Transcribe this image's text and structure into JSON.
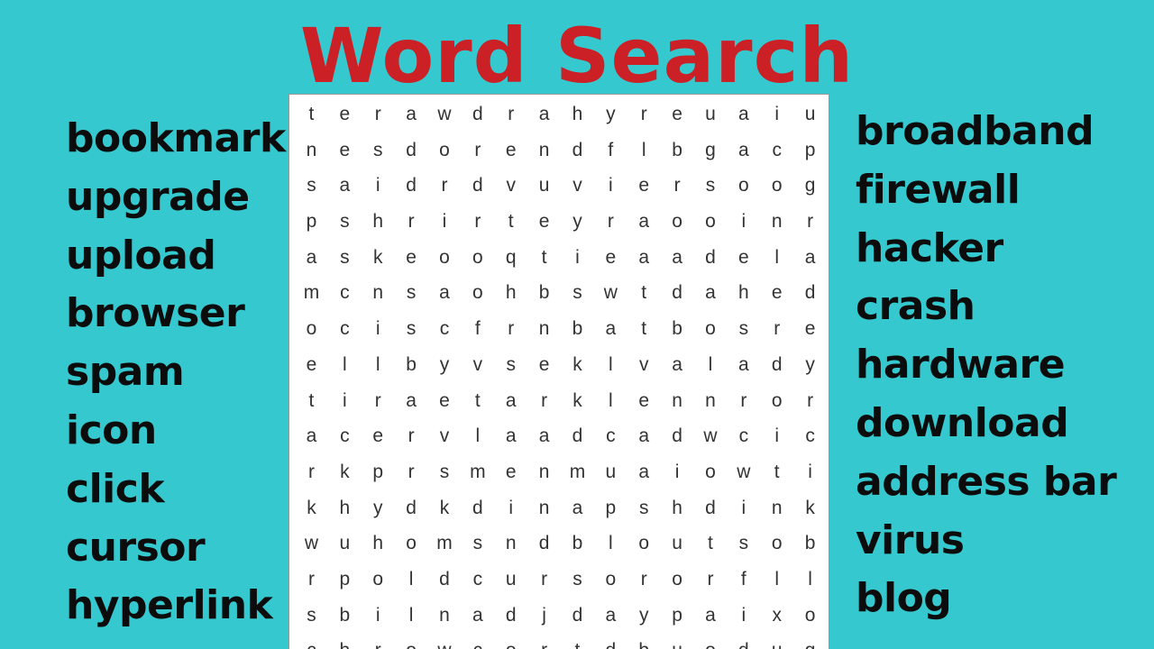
{
  "title": "Word Search",
  "colors": {
    "background": "#35c9cf",
    "title": "#cc2027",
    "grid_background": "#ffffff",
    "word_text": "#0c0c0c"
  },
  "left_words": [
    "bookmark",
    "upgrade",
    "upload",
    "browser",
    "spam",
    "icon",
    "click",
    "cursor",
    "hyperlink"
  ],
  "right_words": [
    "broadband",
    "firewall",
    "hacker",
    "crash",
    "hardware",
    "download",
    "address bar",
    "virus",
    "blog"
  ],
  "grid": [
    [
      "t",
      "e",
      "r",
      "a",
      "w",
      "d",
      "r",
      "a",
      "h",
      "y",
      "r",
      "e",
      "u",
      "a",
      "i",
      "u"
    ],
    [
      "n",
      "e",
      "s",
      "d",
      "o",
      "r",
      "e",
      "n",
      "d",
      "f",
      "l",
      "b",
      "g",
      "a",
      "c",
      "p"
    ],
    [
      "s",
      "a",
      "i",
      "d",
      "r",
      "d",
      "v",
      "u",
      "v",
      "i",
      "e",
      "r",
      "s",
      "o",
      "o",
      "g"
    ],
    [
      "p",
      "s",
      "h",
      "r",
      "i",
      "r",
      "t",
      "e",
      "y",
      "r",
      "a",
      "o",
      "o",
      "i",
      "n",
      "r"
    ],
    [
      "a",
      "s",
      "k",
      "e",
      "o",
      "o",
      "q",
      "t",
      "i",
      "e",
      "a",
      "a",
      "d",
      "e",
      "l",
      "a"
    ],
    [
      "m",
      "c",
      "n",
      "s",
      "a",
      "o",
      "h",
      "b",
      "s",
      "w",
      "t",
      "d",
      "a",
      "h",
      "e",
      "d"
    ],
    [
      "o",
      "c",
      "i",
      "s",
      "c",
      "f",
      "r",
      "n",
      "b",
      "a",
      "t",
      "b",
      "o",
      "s",
      "r",
      "e"
    ],
    [
      "e",
      "l",
      "l",
      "b",
      "y",
      "v",
      "s",
      "e",
      "k",
      "l",
      "v",
      "a",
      "l",
      "a",
      "d",
      "y"
    ],
    [
      "t",
      "i",
      "r",
      "a",
      "e",
      "t",
      "a",
      "r",
      "k",
      "l",
      "e",
      "n",
      "n",
      "r",
      "o",
      "r"
    ],
    [
      "a",
      "c",
      "e",
      "r",
      "v",
      "l",
      "a",
      "a",
      "d",
      "c",
      "a",
      "d",
      "w",
      "c",
      "i",
      "c"
    ],
    [
      "r",
      "k",
      "p",
      "r",
      "s",
      "m",
      "e",
      "n",
      "m",
      "u",
      "a",
      "i",
      "o",
      "w",
      "t",
      "i"
    ],
    [
      "k",
      "h",
      "y",
      "d",
      "k",
      "d",
      "i",
      "n",
      "a",
      "p",
      "s",
      "h",
      "d",
      "i",
      "n",
      "k"
    ],
    [
      "w",
      "u",
      "h",
      "o",
      "m",
      "s",
      "n",
      "d",
      "b",
      "l",
      "o",
      "u",
      "t",
      "s",
      "o",
      "b"
    ],
    [
      "r",
      "p",
      "o",
      "l",
      "d",
      "c",
      "u",
      "r",
      "s",
      "o",
      "r",
      "o",
      "r",
      "f",
      "l",
      "l"
    ],
    [
      "s",
      "b",
      "i",
      "l",
      "n",
      "a",
      "d",
      "j",
      "d",
      "a",
      "y",
      "p",
      "a",
      "i",
      "x",
      "o"
    ],
    [
      "c",
      "h",
      "r",
      "o",
      "w",
      "c",
      "o",
      "r",
      "t",
      "d",
      "b",
      "u",
      "o",
      "d",
      "u",
      "g"
    ]
  ]
}
